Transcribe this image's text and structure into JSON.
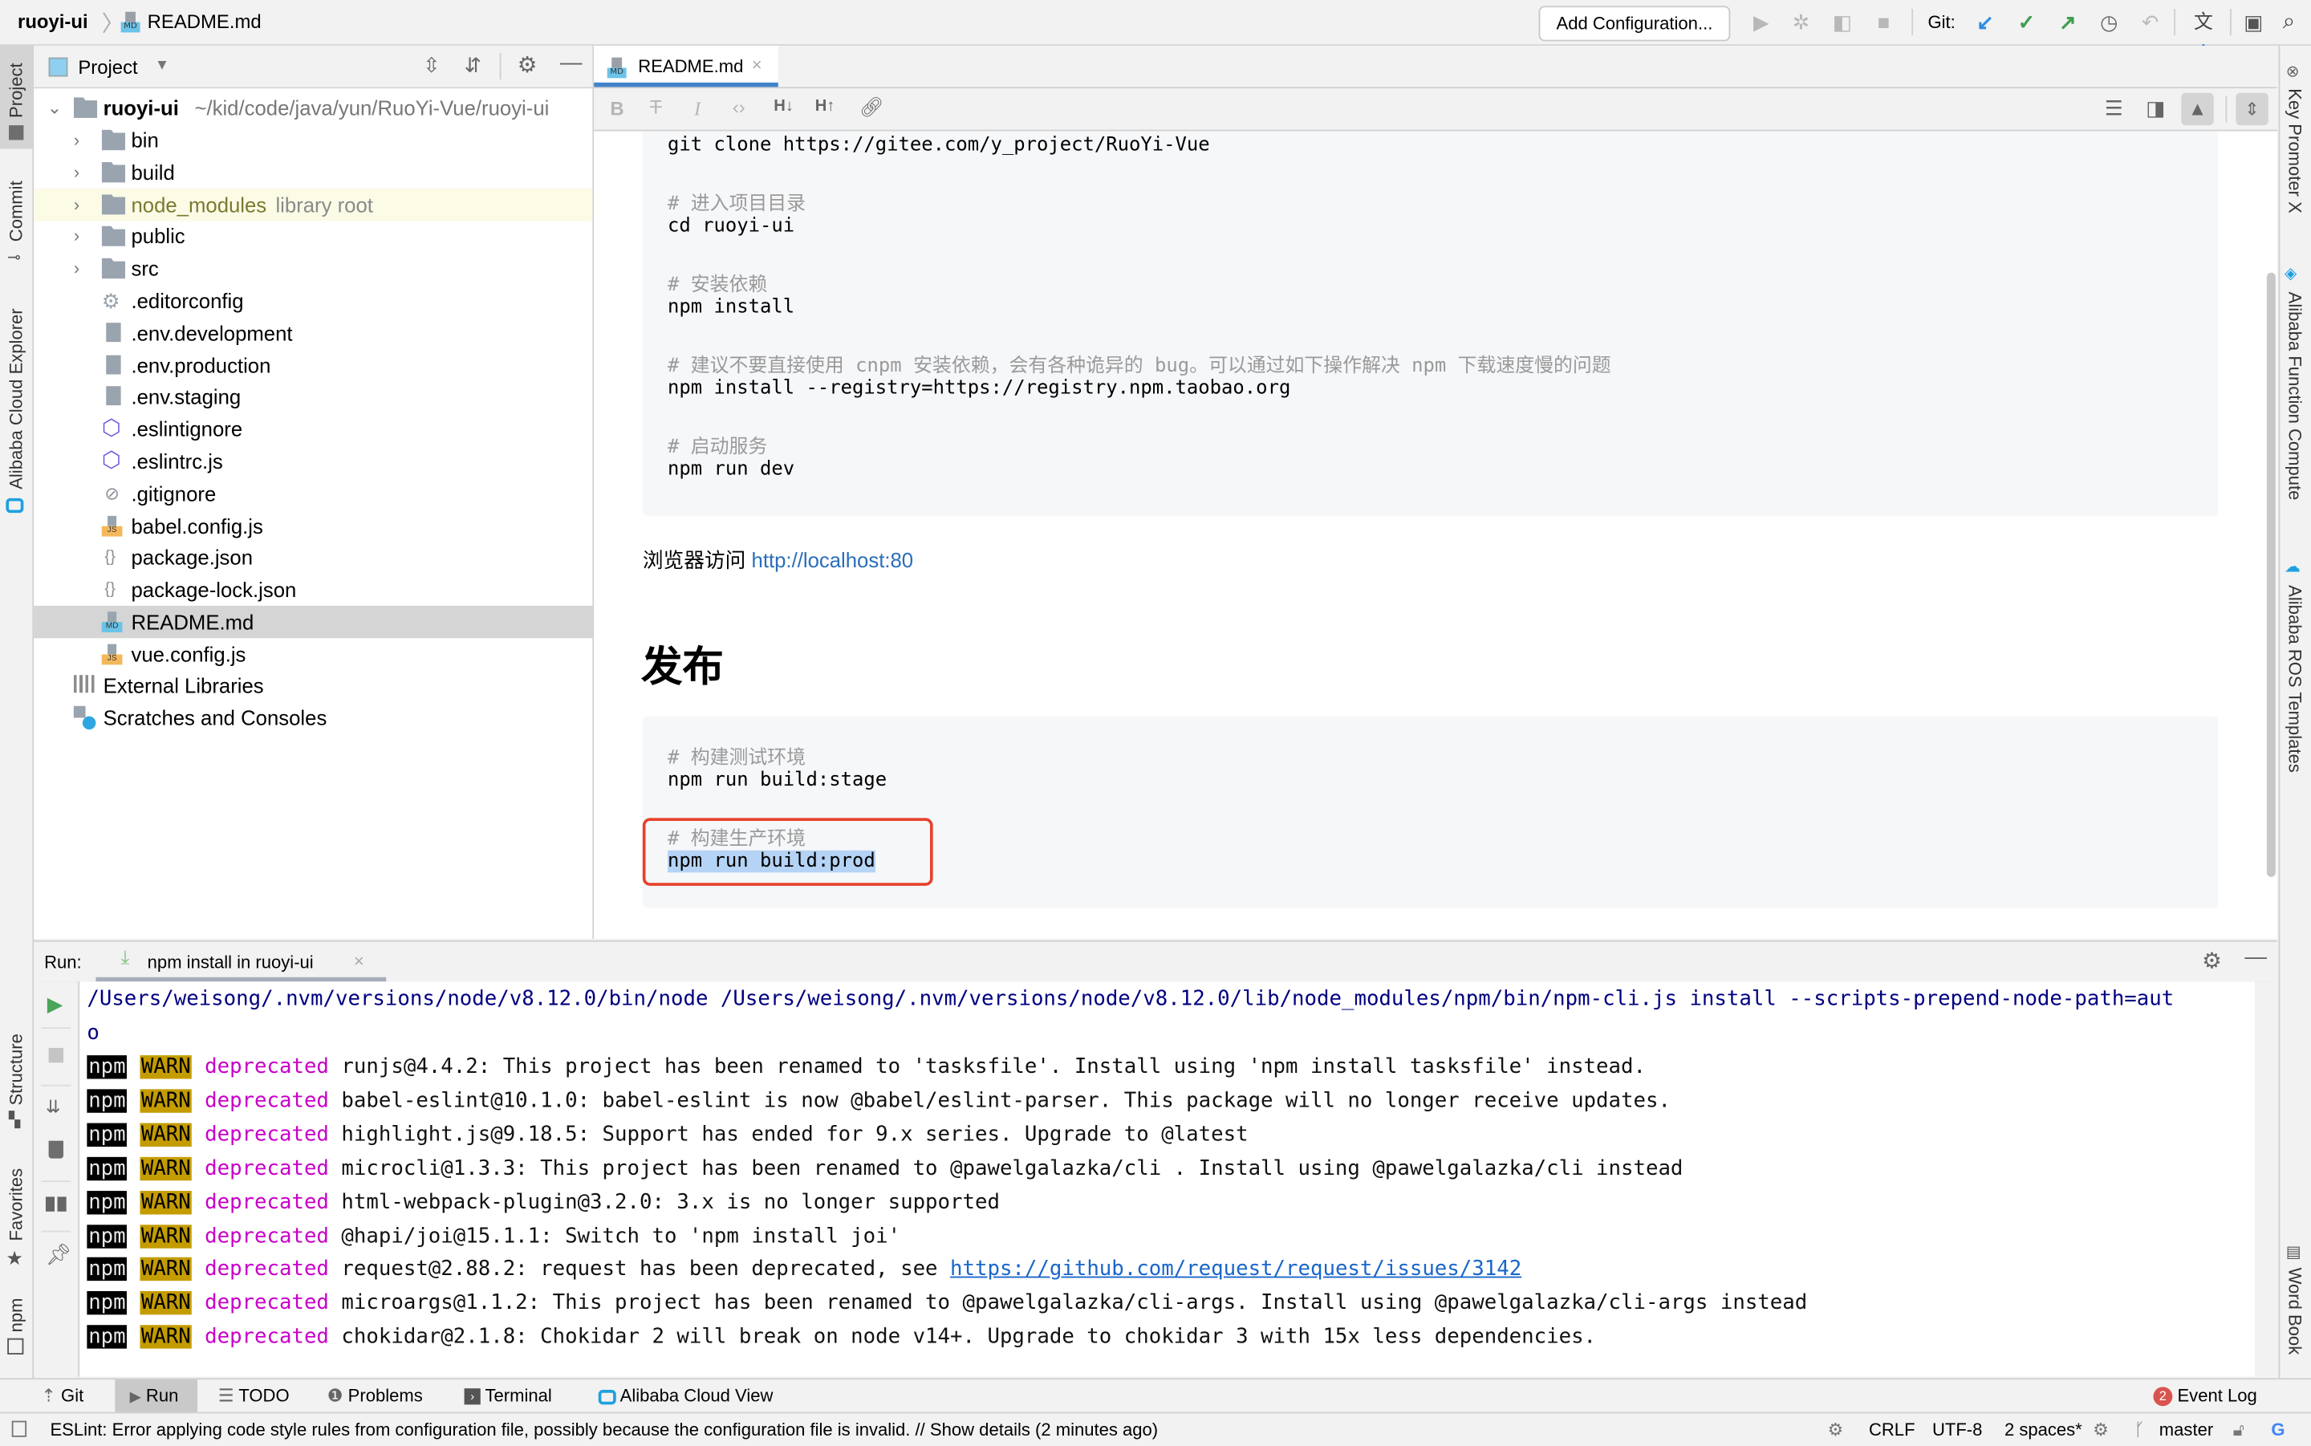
{
  "titlebar": {
    "project": "ruoyi-ui",
    "file": "README.md",
    "add_configuration": "Add Configuration...",
    "git_label": "Git:"
  },
  "left_strip": [
    "Project",
    "Commit",
    "Alibaba Cloud Explorer",
    "Structure",
    "Favorites",
    "npm"
  ],
  "right_strip": [
    "Key Promoter X",
    "Alibaba Function Compute",
    "Alibaba ROS Templates",
    "Word Book"
  ],
  "project_panel": {
    "title": "Project",
    "root": {
      "name": "ruoyi-ui",
      "path": "~/kid/code/java/yun/RuoYi-Vue/ruoyi-ui"
    },
    "items": [
      {
        "name": "bin",
        "type": "folder"
      },
      {
        "name": "build",
        "type": "folder"
      },
      {
        "name": "node_modules",
        "type": "folder",
        "suffix": "library root"
      },
      {
        "name": "public",
        "type": "folder"
      },
      {
        "name": "src",
        "type": "folder"
      },
      {
        "name": ".editorconfig",
        "type": "config"
      },
      {
        "name": ".env.development",
        "type": "text"
      },
      {
        "name": ".env.production",
        "type": "text"
      },
      {
        "name": ".env.staging",
        "type": "text"
      },
      {
        "name": ".eslintignore",
        "type": "eslint"
      },
      {
        "name": ".eslintrc.js",
        "type": "eslint"
      },
      {
        "name": ".gitignore",
        "type": "ignore"
      },
      {
        "name": "babel.config.js",
        "type": "js"
      },
      {
        "name": "package.json",
        "type": "json"
      },
      {
        "name": "package-lock.json",
        "type": "json"
      },
      {
        "name": "README.md",
        "type": "md",
        "selected": true
      },
      {
        "name": "vue.config.js",
        "type": "js"
      }
    ],
    "external_libraries": "External Libraries",
    "scratches": "Scratches and Consoles"
  },
  "editor": {
    "tab": "README.md",
    "code_block_1": [
      {
        "kind": "code",
        "text": "git clone https://gitee.com/y_project/RuoYi-Vue"
      },
      {
        "kind": "comment",
        "text": "# 进入项目目录"
      },
      {
        "kind": "code",
        "text": "cd ruoyi-ui"
      },
      {
        "kind": "comment",
        "text": "# 安装依赖"
      },
      {
        "kind": "code",
        "text": "npm install"
      },
      {
        "kind": "comment",
        "text": "# 建议不要直接使用 cnpm 安装依赖，会有各种诡异的 bug。可以通过如下操作解决 npm 下载速度慢的问题"
      },
      {
        "kind": "code",
        "text": "npm install --registry=https://registry.npm.taobao.org"
      },
      {
        "kind": "comment",
        "text": "# 启动服务"
      },
      {
        "kind": "code",
        "text": "npm run dev"
      }
    ],
    "browser_text": "浏览器访问",
    "browser_link": "http://localhost:80",
    "heading": "发布",
    "code_block_2": [
      {
        "kind": "comment",
        "text": "# 构建测试环境"
      },
      {
        "kind": "code",
        "text": "npm run build:stage"
      },
      {
        "kind": "comment",
        "text": "# 构建生产环境"
      },
      {
        "kind": "code",
        "text": "npm run build:prod",
        "selected": true
      }
    ]
  },
  "run_panel": {
    "label": "Run:",
    "tab": "npm install in ruoyi-ui",
    "command_line": "/Users/weisong/.nvm/versions/node/v8.12.0/bin/node /Users/weisong/.nvm/versions/node/v8.12.0/lib/node_modules/npm/bin/npm-cli.js install --scripts-prepend-node-path=aut",
    "command_wrap": "o",
    "warnings": [
      {
        "text": "runjs@4.4.2: This project has been renamed to 'tasksfile'. Install using 'npm install tasksfile' instead."
      },
      {
        "text": "babel-eslint@10.1.0: babel-eslint is now @babel/eslint-parser. This package will no longer receive updates."
      },
      {
        "text": "highlight.js@9.18.5: Support has ended for 9.x series. Upgrade to @latest"
      },
      {
        "text": "microcli@1.3.3: This project has been renamed to @pawelgalazka/cli . Install using @pawelgalazka/cli instead"
      },
      {
        "text": "html-webpack-plugin@3.2.0: 3.x is no longer supported"
      },
      {
        "text": "@hapi/joi@15.1.1: Switch to 'npm install joi'"
      },
      {
        "text": "request@2.88.2: request has been deprecated, see ",
        "link": "https://github.com/request/request/issues/3142"
      },
      {
        "text": "microargs@1.1.2: This project has been renamed to @pawelgalazka/cli-args. Install using @pawelgalazka/cli-args instead"
      },
      {
        "text": "chokidar@2.1.8: Chokidar 2 will break on node v14+. Upgrade to chokidar 3 with 15x less dependencies."
      }
    ],
    "npm_tag": "npm",
    "warn_tag": "WARN",
    "deprecated_tag": "deprecated"
  },
  "tool_windows": {
    "git": "Git",
    "run": "Run",
    "todo": "TODO",
    "problems": "Problems",
    "terminal": "Terminal",
    "alibaba": "Alibaba Cloud View",
    "event_log": "Event Log",
    "event_count": "2"
  },
  "status_bar": {
    "message": "ESLint: Error applying code style rules from configuration file, possibly because the configuration file is invalid. // Show details (2 minutes ago)",
    "line_sep": "CRLF",
    "encoding": "UTF-8",
    "indent": "2 spaces*",
    "branch": "master"
  },
  "colors": {
    "accent": "#4083c9",
    "selection": "#b5d3f5",
    "highlight_box": "#e8412c",
    "deprecated": "#c800c8",
    "warn_bg": "#c49c00",
    "link": "#1a66c9"
  }
}
